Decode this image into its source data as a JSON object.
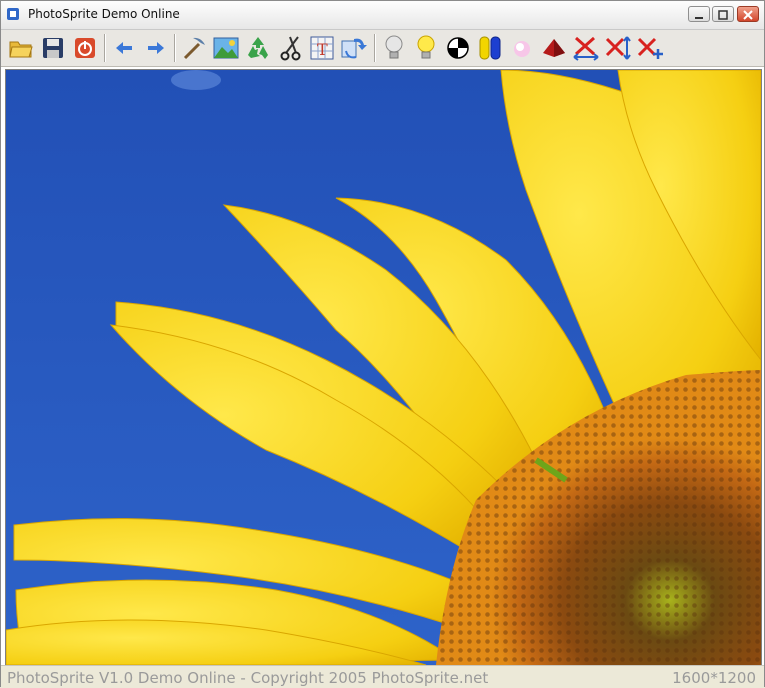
{
  "window": {
    "title": "PhotoSprite Demo Online"
  },
  "toolbar": {
    "tools": [
      {
        "name": "open",
        "icon": "folder-open-icon"
      },
      {
        "name": "save",
        "icon": "floppy-disk-icon"
      },
      {
        "name": "power",
        "icon": "power-icon"
      },
      {
        "name": "undo",
        "icon": "arrow-left-icon"
      },
      {
        "name": "redo",
        "icon": "arrow-right-icon"
      },
      {
        "name": "pick",
        "icon": "pickaxe-icon"
      },
      {
        "name": "image",
        "icon": "landscape-icon"
      },
      {
        "name": "recycle",
        "icon": "recycle-icon"
      },
      {
        "name": "scissors",
        "icon": "scissors-icon"
      },
      {
        "name": "text",
        "icon": "text-grid-icon"
      },
      {
        "name": "transform",
        "icon": "transform-icon"
      },
      {
        "name": "bulb-off",
        "icon": "bulb-off-icon"
      },
      {
        "name": "bulb-on",
        "icon": "bulb-on-icon"
      },
      {
        "name": "checker",
        "icon": "checker-icon"
      },
      {
        "name": "channels",
        "icon": "channels-icon"
      },
      {
        "name": "soft",
        "icon": "soft-blob-icon"
      },
      {
        "name": "pyramid",
        "icon": "pyramid-icon"
      },
      {
        "name": "flip-h",
        "icon": "flip-horizontal-icon"
      },
      {
        "name": "flip-v",
        "icon": "flip-vertical-icon"
      },
      {
        "name": "resize",
        "icon": "resize-cross-icon"
      }
    ]
  },
  "status": {
    "left": "PhotoSprite V1.0 Demo Online - Copyright 2005 PhotoSprite.net",
    "right": "1600*1200"
  },
  "colors": {
    "sky": "#2453b8",
    "petal": "#f5d51e",
    "center": "#8a4a12"
  }
}
